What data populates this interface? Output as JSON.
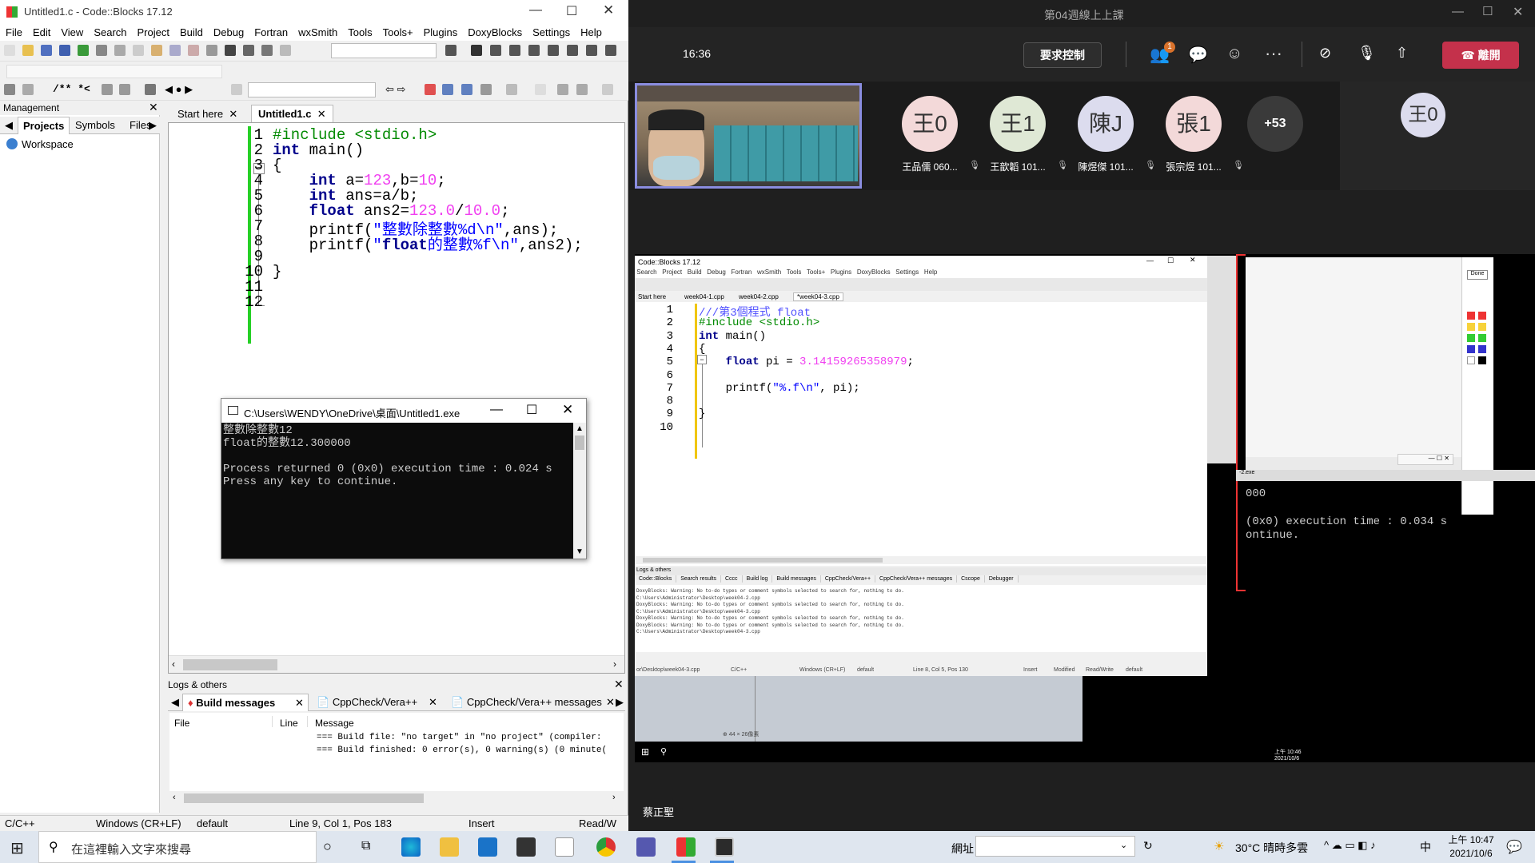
{
  "codeblocks": {
    "title": "Untitled1.c - Code::Blocks 17.12",
    "menu": [
      "File",
      "Edit",
      "View",
      "Search",
      "Project",
      "Build",
      "Debug",
      "Fortran",
      "wxSmith",
      "Tools",
      "Tools+",
      "Plugins",
      "DoxyBlocks",
      "Settings",
      "Help"
    ],
    "management": {
      "title": "Management",
      "tabs": [
        "Projects",
        "Symbols",
        "Files"
      ],
      "workspace": "Workspace"
    },
    "editor_tabs": [
      "Start here",
      "Untitled1.c"
    ],
    "code_lines": [
      {
        "n": "1",
        "text": "#include <stdio.h>"
      },
      {
        "n": "2",
        "text": "int main()"
      },
      {
        "n": "3",
        "text": "{"
      },
      {
        "n": "4",
        "text": "    int a=123,b=10;"
      },
      {
        "n": "5",
        "text": "    int ans=a/b;"
      },
      {
        "n": "6",
        "text": "    float ans2=123.0/10.0;"
      },
      {
        "n": "7",
        "text": "    printf(\"整數除整數%d\\n\",ans);"
      },
      {
        "n": "8",
        "text": "    printf(\"float的整數%f\\n\",ans2);"
      },
      {
        "n": "9",
        "text": ""
      },
      {
        "n": "10",
        "text": "}"
      },
      {
        "n": "11",
        "text": ""
      },
      {
        "n": "12",
        "text": ""
      }
    ],
    "console": {
      "title": "C:\\Users\\WENDY\\OneDrive\\桌面\\Untitled1.exe",
      "lines": [
        "整數除整數12",
        "float的整數12.300000",
        "",
        "Process returned 0 (0x0)   execution time : 0.024 s",
        "Press any key to continue."
      ]
    },
    "logs": {
      "title": "Logs & others",
      "tabs": [
        "Build messages",
        "CppCheck/Vera++",
        "CppCheck/Vera++ messages"
      ],
      "columns": [
        "File",
        "Line",
        "Message"
      ],
      "rows": [
        "=== Build file: \"no target\" in \"no project\" (compiler:",
        "=== Build finished: 0 error(s), 0 warning(s) (0 minute("
      ]
    },
    "status": [
      "C/C++",
      "Windows (CR+LF)",
      "default",
      "Line 9, Col 1, Pos 183",
      "Insert",
      "Read/W"
    ]
  },
  "teams": {
    "title": "第04週線上上課",
    "time": "16:36",
    "control_button": "要求控制",
    "leave_button": "離開",
    "participants": [
      {
        "initial": "王0",
        "name": "王品儒 060...",
        "color": "#f3d9d9"
      },
      {
        "initial": "王1",
        "name": "王歆韜 101...",
        "color": "#dfe8d5"
      },
      {
        "initial": "陳J",
        "name": "陳煜傑 101...",
        "color": "#dcdcee"
      },
      {
        "initial": "張1",
        "name": "張宗煜 101...",
        "color": "#f3d9d9"
      }
    ],
    "more_count": "+53",
    "side_avatar": "王0",
    "presenter": "蔡正聖"
  },
  "shared": {
    "title": "Code::Blocks 17.12",
    "tabs": [
      "Start here",
      "week04-1.cpp",
      "week04-2.cpp",
      "*week04-3.cpp"
    ],
    "code_lines": [
      {
        "n": "1",
        "text": "///第3個程式 float"
      },
      {
        "n": "2",
        "text": "#include <stdio.h>"
      },
      {
        "n": "3",
        "text": "int main()"
      },
      {
        "n": "4",
        "text": "{"
      },
      {
        "n": "5",
        "text": "    float pi = 3.14159265358979;"
      },
      {
        "n": "6",
        "text": ""
      },
      {
        "n": "7",
        "text": "    printf(\"%.f\\n\", pi);"
      },
      {
        "n": "8",
        "text": ""
      },
      {
        "n": "9",
        "text": "}"
      },
      {
        "n": "10",
        "text": ""
      }
    ],
    "console_lines": [
      "000",
      "(0x0)   execution time : 0.034 s",
      "ontinue."
    ],
    "log_tabs": [
      "Code::Blocks",
      "Search results",
      "Cccc",
      "Build log",
      "Build messages",
      "CppCheck/Vera++",
      "CppCheck/Vera++ messages",
      "Cscope",
      "Debugger"
    ],
    "status": [
      "Windows (CR+LF)",
      "default",
      "Line 8, Col 5, Pos 130",
      "Insert",
      "Modified",
      "Read/Write",
      "default"
    ]
  },
  "taskbar": {
    "search_placeholder": "在這裡輸入文字來搜尋",
    "address_label": "網址",
    "weather": "30°C 晴時多雲",
    "ime": "中",
    "time": "上午 10:47",
    "date": "2021/10/6"
  }
}
